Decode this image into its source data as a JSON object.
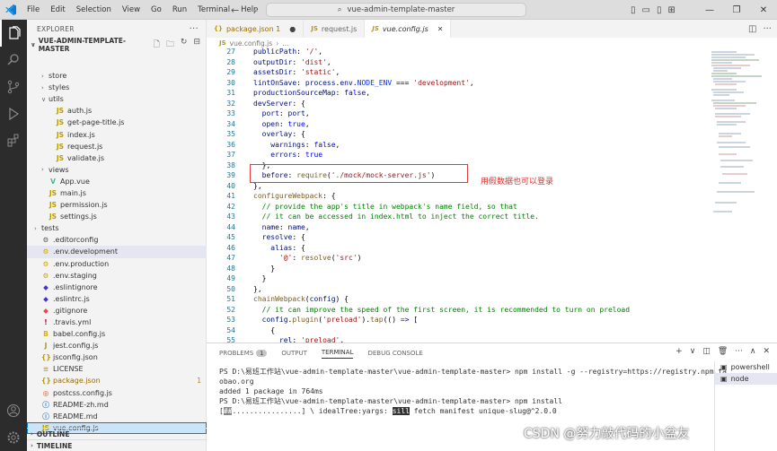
{
  "titlebar": {
    "menu": [
      "File",
      "Edit",
      "Selection",
      "View",
      "Go",
      "Run",
      "Terminal",
      "Help"
    ],
    "search": "vue-admin-template-master"
  },
  "sidebar": {
    "header": "EXPLORER",
    "root": "VUE-ADMIN-TEMPLATE-MASTER",
    "items": [
      {
        "label": "store",
        "kind": "folder",
        "depth": 1,
        "icon": "chevron-right"
      },
      {
        "label": "styles",
        "kind": "folder",
        "depth": 1,
        "icon": "chevron-right"
      },
      {
        "label": "utils",
        "kind": "folder",
        "depth": 1,
        "icon": "chevron-down"
      },
      {
        "label": "auth.js",
        "kind": "js",
        "depth": 2
      },
      {
        "label": "get-page-title.js",
        "kind": "js",
        "depth": 2
      },
      {
        "label": "index.js",
        "kind": "js",
        "depth": 2
      },
      {
        "label": "request.js",
        "kind": "js",
        "depth": 2
      },
      {
        "label": "validate.js",
        "kind": "js",
        "depth": 2
      },
      {
        "label": "views",
        "kind": "folder",
        "depth": 1,
        "icon": "chevron-right"
      },
      {
        "label": "App.vue",
        "kind": "vue",
        "depth": 1
      },
      {
        "label": "main.js",
        "kind": "js",
        "depth": 1
      },
      {
        "label": "permission.js",
        "kind": "js",
        "depth": 1
      },
      {
        "label": "settings.js",
        "kind": "js",
        "depth": 1
      },
      {
        "label": "tests",
        "kind": "folder",
        "depth": 0,
        "icon": "chevron-right"
      },
      {
        "label": ".editorconfig",
        "kind": "cfg",
        "depth": 0
      },
      {
        "label": ".env.development",
        "kind": "env",
        "depth": 0
      },
      {
        "label": ".env.production",
        "kind": "env",
        "depth": 0
      },
      {
        "label": ".env.staging",
        "kind": "env",
        "depth": 0
      },
      {
        "label": ".eslintignore",
        "kind": "eslint",
        "depth": 0
      },
      {
        "label": ".eslintrc.js",
        "kind": "eslint",
        "depth": 0
      },
      {
        "label": ".gitignore",
        "kind": "git",
        "depth": 0
      },
      {
        "label": ".travis.yml",
        "kind": "yml",
        "depth": 0
      },
      {
        "label": "babel.config.js",
        "kind": "babel",
        "depth": 0
      },
      {
        "label": "jest.config.js",
        "kind": "jest",
        "depth": 0
      },
      {
        "label": "jsconfig.json",
        "kind": "json",
        "depth": 0
      },
      {
        "label": "LICENSE",
        "kind": "license",
        "depth": 0
      },
      {
        "label": "package.json",
        "kind": "json",
        "depth": 0,
        "badge": "1"
      },
      {
        "label": "postcss.config.js",
        "kind": "postcss",
        "depth": 0
      },
      {
        "label": "README-zh.md",
        "kind": "md",
        "depth": 0
      },
      {
        "label": "README.md",
        "kind": "md",
        "depth": 0
      },
      {
        "label": "vue.config.js",
        "kind": "js",
        "depth": 0
      }
    ],
    "outline": "OUTLINE",
    "timeline": "TIMELINE"
  },
  "tabs": [
    {
      "icon": "{}",
      "label": "package.json 1",
      "state": "dot"
    },
    {
      "icon": "JS",
      "label": "request.js",
      "state": ""
    },
    {
      "icon": "JS",
      "label": "vue.config.js",
      "state": "x"
    }
  ],
  "breadcrumb": {
    "icon": "JS",
    "file": "vue.config.js",
    "more": "..."
  },
  "code": {
    "line_numbers": [
      "27",
      "28",
      "29",
      "30",
      "31",
      "32",
      "33",
      "34",
      "35",
      "36",
      "37",
      "38",
      "39",
      "40",
      "41",
      "42",
      "43",
      "44",
      "45",
      "46",
      "47",
      "48",
      "49",
      "50",
      "51",
      "52",
      "53",
      "54",
      "55"
    ]
  },
  "annotation": "用假数据也可以登录",
  "panel": {
    "tabs": [
      "PROBLEMS",
      "OUTPUT",
      "TERMINAL",
      "DEBUG CONSOLE"
    ],
    "problems_count": "1",
    "terminal_lines": [
      "PS D:\\易班工作站\\vue-admin-template-master\\vue-admin-template-master> npm install -g --registry=https://registry.npm.ta",
      "obao.org",
      "",
      "added 1 package in 764ms",
      "PS D:\\易班工作站\\vue-admin-template-master\\vue-admin-template-master> npm install"
    ],
    "progress_prefix": "[",
    "progress_fill": "##",
    "progress_rest": "................] \\ idealTree:yargs: ",
    "progress_tag": "sill",
    "progress_tail": " fetch manifest unique-slug@^2.0.0",
    "terminals": [
      "powershell",
      "node"
    ]
  },
  "watermark": "CSDN @努力敲代码的小盆友"
}
